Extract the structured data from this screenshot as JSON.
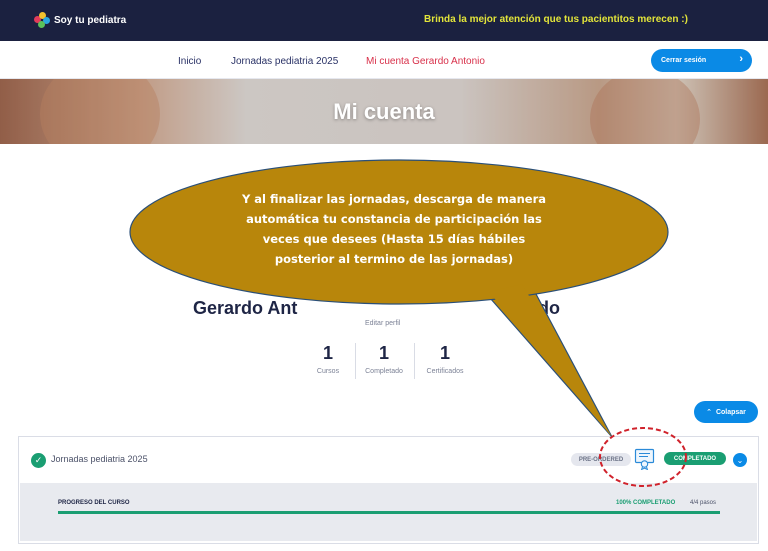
{
  "brand": {
    "name": "Soy tu pediatra",
    "tagline": "Brinda la mejor atención que tus pacientitos merecen :)"
  },
  "nav": {
    "items": [
      {
        "label": "Inicio"
      },
      {
        "label": "Jornadas pediatria 2025"
      },
      {
        "label": "Mi cuenta Gerardo Antonio"
      }
    ],
    "logout_label": "Cerrar sesión",
    "logout_icon": "chevron-right-icon"
  },
  "hero": {
    "title": "Mi cuenta"
  },
  "profile": {
    "name_start": "Gerardo Ant",
    "name_end": "ocido",
    "edit_label": "Editar perfil",
    "stats": [
      {
        "value": "1",
        "label": "Cursos"
      },
      {
        "value": "1",
        "label": "Completado"
      },
      {
        "value": "1",
        "label": "Certificados"
      }
    ]
  },
  "collapse_label": "Colapsar",
  "course": {
    "title": "Jornadas pediatria 2025",
    "badge_pre": "PRE-ORDERED",
    "badge_done": "COMPLETADO",
    "progress_label": "PROGRESO DEL CURSO",
    "progress_pct_text": "100% COMPLETADO",
    "progress_steps": "4/4 pasos",
    "progress_value": 1.0
  },
  "annotation": {
    "text_lines": [
      "Y al finalizar las jornadas, descarga de manera",
      "automática tu constancia de participación las",
      "veces que desees (Hasta 15 días hábiles",
      "posterior al termino de las jornadas)"
    ]
  },
  "colors": {
    "topbar": "#1b2140",
    "accent": "#0a8ae6",
    "success": "#1a9e72",
    "active_nav": "#d8304a",
    "callout_fill": "#b8860b",
    "callout_circle": "#d0222b"
  }
}
